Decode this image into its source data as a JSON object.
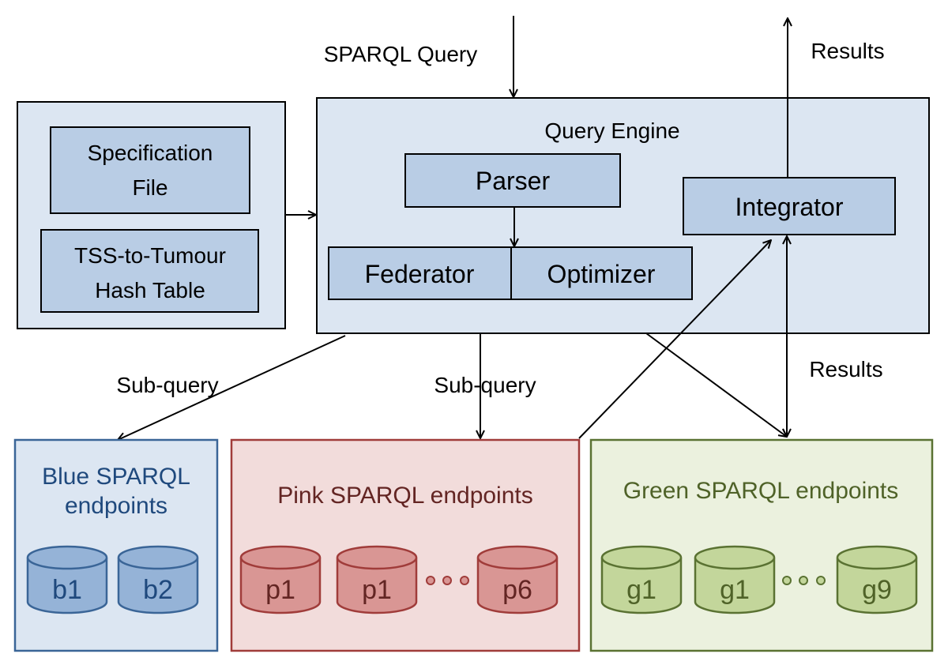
{
  "labels": {
    "sparql_query": "SPARQL Query",
    "results_top": "Results",
    "results_mid": "Results",
    "subquery_left": "Sub-query",
    "subquery_mid": "Sub-query"
  },
  "config_box": {
    "specification_line1": "Specification",
    "specification_line2": "File",
    "hash_line1": "TSS-to-Tumour",
    "hash_line2": "Hash Table"
  },
  "query_engine": {
    "title": "Query Engine",
    "parser": "Parser",
    "federator": "Federator",
    "optimizer": "Optimizer",
    "integrator": "Integrator"
  },
  "endpoints": {
    "blue": {
      "title_line1": "Blue SPARQL",
      "title_line2": "endpoints",
      "dbs": [
        "b1",
        "b2"
      ],
      "color": "#1f497d",
      "fill": "#dce6f2",
      "db_fill": "#95b3d7"
    },
    "pink": {
      "title": "Pink SPARQL endpoints",
      "dbs": [
        "p1",
        "p1",
        "p6"
      ],
      "color": "#632523",
      "fill": "#f2dcdb",
      "db_fill": "#d99694"
    },
    "green": {
      "title": "Green SPARQL endpoints",
      "dbs": [
        "g1",
        "g1",
        "g9"
      ],
      "color": "#4f6228",
      "fill": "#ebf1de",
      "db_fill": "#c3d69b"
    }
  }
}
